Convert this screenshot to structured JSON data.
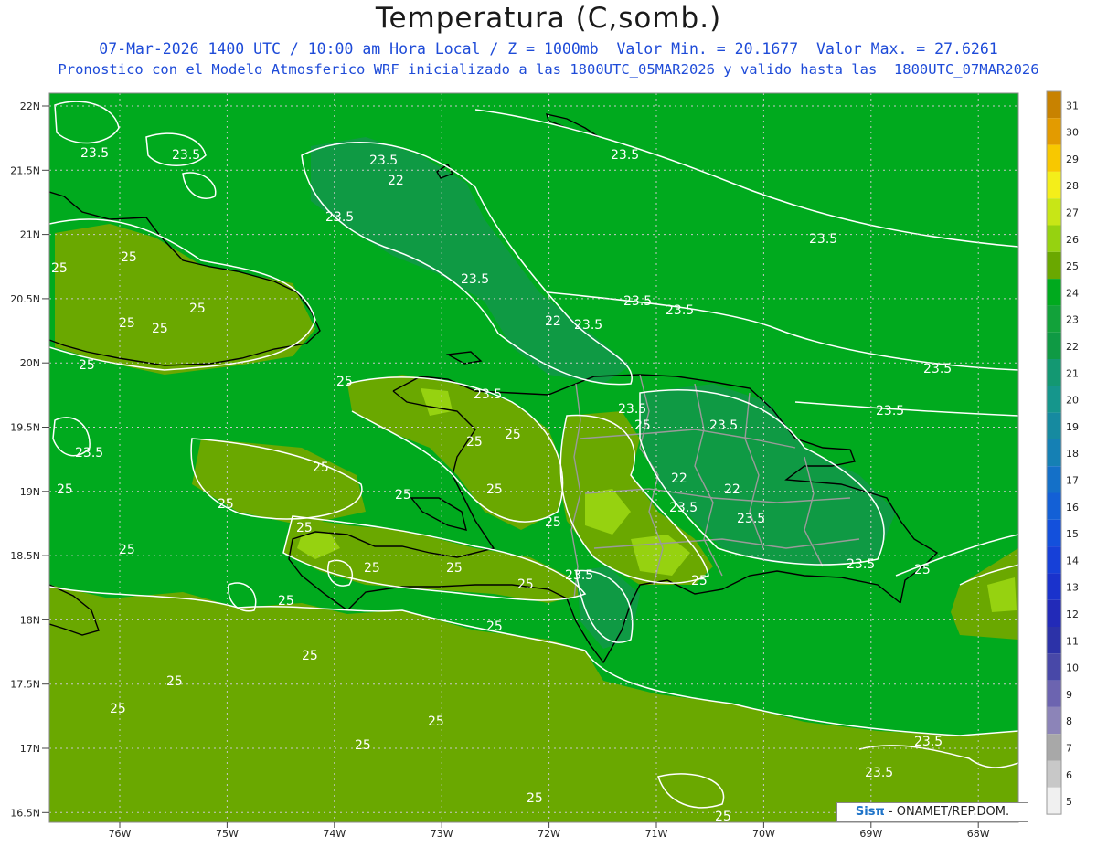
{
  "header": {
    "title": "Temperatura (C,somb.)",
    "subtitle_line1": "07-Mar-2026 1400 UTC / 10:00 am Hora Local / Z = 1000mb  Valor Min. = 20.1677  Valor Max. = 27.6261",
    "subtitle_line2": "Pronostico con el Modelo Atmosferico WRF inicializado a las 1800UTC_05MAR2026 y valido hasta las  1800UTC_07MAR2026"
  },
  "map": {
    "lat_labels": [
      "22N",
      "21.5N",
      "21N",
      "20.5N",
      "20N",
      "19.5N",
      "19N",
      "18.5N",
      "18N",
      "17.5N",
      "17N",
      "16.5N"
    ],
    "lon_labels": [
      "76W",
      "75W",
      "74W",
      "73W",
      "72W",
      "71W",
      "70W",
      "69W",
      "68W"
    ],
    "contour_labels": [
      "23.5",
      "25",
      "22"
    ],
    "dominant_field_color": "#00aa1e",
    "warm_field_color": "#6aa800",
    "cool_field_color": "#0f9a44"
  },
  "legend": {
    "labels": [
      "31",
      "30",
      "29",
      "28",
      "27",
      "26",
      "25",
      "24",
      "23",
      "22",
      "21",
      "20",
      "19",
      "18",
      "17",
      "16",
      "15",
      "14",
      "13",
      "12",
      "11",
      "10",
      "9",
      "8",
      "7",
      "6",
      "5"
    ],
    "colors": [
      "#c88200",
      "#e39b00",
      "#f8c800",
      "#f4ee1a",
      "#c8e616",
      "#96d210",
      "#6aa800",
      "#00aa1e",
      "#12a23a",
      "#0f9a44",
      "#139872",
      "#15968c",
      "#168aa0",
      "#1580b4",
      "#1470c8",
      "#1360d6",
      "#1350dc",
      "#1640d8",
      "#1a32cc",
      "#222ab8",
      "#2c32a8",
      "#4848a8",
      "#6c64b0",
      "#8c84b8",
      "#a8a8a8",
      "#c8c8c8",
      "#f0f0f0"
    ]
  },
  "credit": {
    "logo": "Sisπ",
    "text": " - ONAMET/REP.DOM."
  }
}
